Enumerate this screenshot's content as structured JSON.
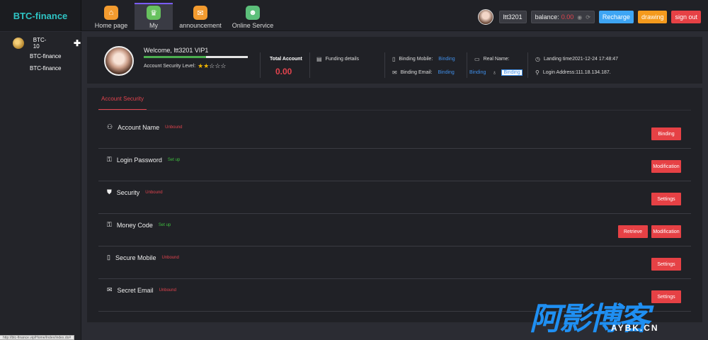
{
  "brand": "BTC-finance",
  "nav": [
    {
      "label": "Home page",
      "icon": "home-icon",
      "color": "#f39b2f",
      "glyph": "⌂"
    },
    {
      "label": "My",
      "icon": "crown-icon",
      "color": "#67c15e",
      "glyph": "♛"
    },
    {
      "label": "announcement",
      "icon": "mail-icon",
      "color": "#f39b2f",
      "glyph": "✉"
    },
    {
      "label": "Online Service",
      "icon": "person-icon",
      "color": "#5cbf7a",
      "glyph": "☻"
    }
  ],
  "topbar": {
    "username": "ltt3201",
    "balance_label": "balance:",
    "balance_value": "0.00",
    "eye": "◉",
    "refresh": "⟳",
    "recharge": "Recharge",
    "drawing": "drawing",
    "signout": "sign out"
  },
  "sidebar": {
    "title": "BTC-10",
    "plus": "✚",
    "items": [
      "BTC-finance",
      "BTC-finance"
    ]
  },
  "user": {
    "welcome": "Welcome, ltt3201 VIP1",
    "security_level_label": "Account Security Level:",
    "security_progress": 0.6,
    "stars_on": "★★",
    "stars_off": "☆☆☆",
    "total_account_label": "Total Account",
    "total_account_value": "0.00",
    "funding_details": "Funding details",
    "binding_mobile_label": "Binding Mobile:",
    "binding_mobile_value": "Binding",
    "binding_email_label": "Binding Email:",
    "binding_email_value": "Binding",
    "real_name_label": "Real Name:",
    "qq_binding_left": "Binding",
    "qq_binding_box": "Binding",
    "landing_time": "Landing time2021-12-24 17:48:47",
    "login_address": "Login Address:111.18.134.187."
  },
  "security": {
    "tab": "Account Security",
    "rows": [
      {
        "title": "Account Name",
        "status": "Unbound",
        "status_color": "red",
        "buttons": [
          "Binding"
        ]
      },
      {
        "title": "Login Password",
        "status": "Set up",
        "status_color": "green",
        "buttons": [
          "Modification"
        ]
      },
      {
        "title": "Security",
        "status": "Unbound",
        "status_color": "red",
        "buttons": [
          "Settings"
        ]
      },
      {
        "title": "Money Code",
        "status": "Set up",
        "status_color": "green",
        "buttons": [
          "Retrieve",
          "Modification"
        ]
      },
      {
        "title": "Secure Mobile",
        "status": "Unbound",
        "status_color": "red",
        "buttons": [
          "Settings"
        ]
      },
      {
        "title": "Secret Email",
        "status": "Unbound",
        "status_color": "red",
        "buttons": [
          "Settings"
        ]
      }
    ]
  },
  "watermark": {
    "cn": "阿影博客",
    "en": "AYBK.CN"
  },
  "statusbar": "http://btc-finance.vip/Home/Index/index.do#"
}
